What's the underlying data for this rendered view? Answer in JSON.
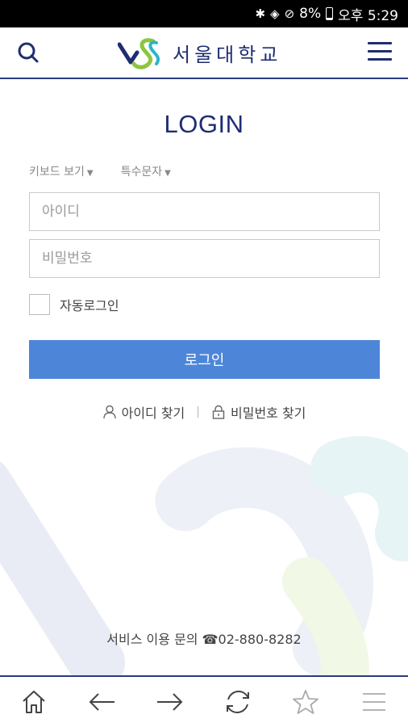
{
  "status_bar": {
    "battery": "8%",
    "time": "오후 5:29"
  },
  "header": {
    "logo_text": "서울대학교"
  },
  "login": {
    "title": "LOGIN",
    "keyboard_toggle": "키보드 보기",
    "special_chars_toggle": "특수문자",
    "id_placeholder": "아이디",
    "password_placeholder": "비밀번호",
    "auto_login_label": "자동로그인",
    "login_button": "로그인",
    "find_id": "아이디 찾기",
    "find_password": "비밀번호 찾기",
    "separator": "|"
  },
  "footer": {
    "service_inquiry": "서비스 이용 문의 ☎02-880-8282"
  },
  "colors": {
    "brand": "#1f2d72",
    "button": "#4d86d8",
    "accent_green": "#8cc63f"
  },
  "bottom_nav": [
    "home-icon",
    "back-arrow-icon",
    "forward-arrow-icon",
    "refresh-icon",
    "star-icon",
    "menu-icon"
  ]
}
